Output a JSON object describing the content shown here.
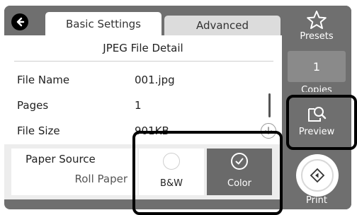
{
  "tabs": {
    "basic": "Basic Settings",
    "advanced": "Advanced"
  },
  "panel": {
    "title": "JPEG File Detail",
    "rows": [
      {
        "label": "File Name",
        "value": "001.jpg"
      },
      {
        "label": "Pages",
        "value": "1"
      },
      {
        "label": "File Size",
        "value": "901KB"
      }
    ]
  },
  "paper_source": {
    "label": "Paper Source",
    "value": "Roll Paper"
  },
  "color_mode": {
    "options": [
      {
        "label": "B&W",
        "selected": false
      },
      {
        "label": "Color",
        "selected": true
      }
    ]
  },
  "side": {
    "presets_label": "Presets",
    "copies_value": "1",
    "copies_label": "Copies",
    "preview_label": "Preview",
    "print_label": "Print"
  },
  "icons": {
    "back": "back-arrow-icon",
    "presets": "star-icon",
    "preview": "magnifier-icon",
    "print": "print-diamond-icon",
    "scroll_down": "arrow-down-icon",
    "check": "check-icon"
  },
  "colors": {
    "bezel": "#6f6f6f",
    "selected_option": "#6a6a6a",
    "highlight": "#000000"
  }
}
